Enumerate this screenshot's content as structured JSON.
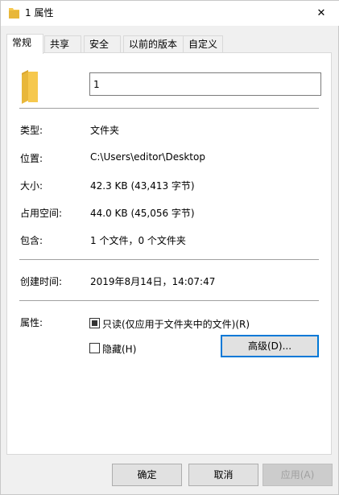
{
  "window": {
    "title": "1 属性",
    "close_glyph": "✕"
  },
  "tabs": [
    {
      "label": "常规",
      "active": true
    },
    {
      "label": "共享"
    },
    {
      "label": "安全"
    },
    {
      "label": "以前的版本"
    },
    {
      "label": "自定义"
    }
  ],
  "general": {
    "name_value": "1",
    "type": {
      "label": "类型:",
      "value": "文件夹"
    },
    "location": {
      "label": "位置:",
      "value": "C:\\Users\\editor\\Desktop"
    },
    "size": {
      "label": "大小:",
      "value": "42.3 KB (43,413 字节)"
    },
    "size_on_disk": {
      "label": "占用空间:",
      "value": "44.0 KB (45,056 字节)"
    },
    "contains": {
      "label": "包含:",
      "value": "1 个文件，0 个文件夹"
    },
    "created": {
      "label": "创建时间:",
      "value": "2019年8月14日，14:07:47"
    },
    "attributes": {
      "label": "属性:",
      "readonly_label": "只读(仅应用于文件夹中的文件)(R)",
      "readonly_state": "indeterminate",
      "hidden_label": "隐藏(H)",
      "hidden_checked": false,
      "advanced_label": "高级(D)..."
    }
  },
  "footer": {
    "ok_label": "确定",
    "cancel_label": "取消",
    "apply_label": "应用(A)"
  },
  "colors": {
    "folder": "#f6c84d",
    "accent_focus": "#0078d7"
  }
}
